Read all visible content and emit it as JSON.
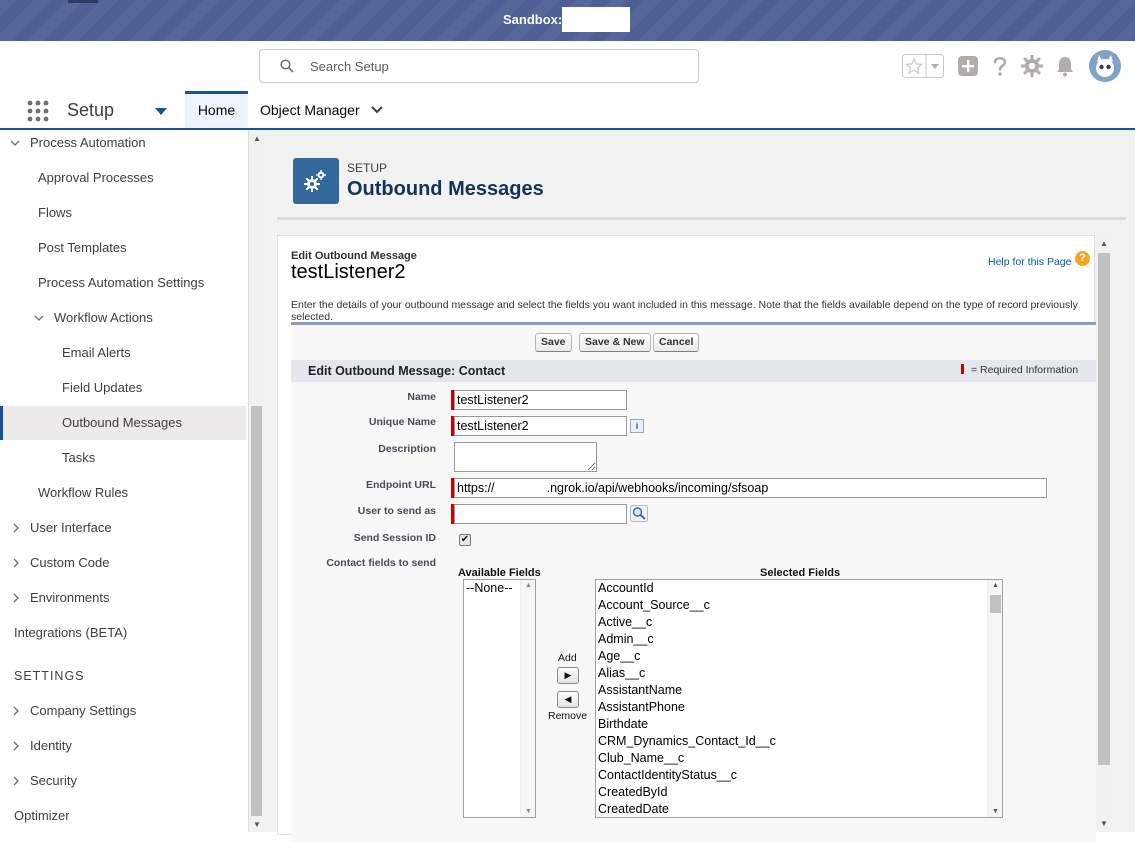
{
  "sandbox": {
    "label": "Sandbox:",
    "name": ""
  },
  "search": {
    "placeholder": "Search Setup"
  },
  "nav": {
    "app_name": "Setup",
    "tabs": [
      {
        "label": "Home"
      },
      {
        "label": "Object Manager"
      }
    ]
  },
  "sidebar": {
    "items": [
      {
        "label": "Process Automation"
      },
      {
        "label": "Approval Processes"
      },
      {
        "label": "Flows"
      },
      {
        "label": "Post Templates"
      },
      {
        "label": "Process Automation Settings"
      },
      {
        "label": "Workflow Actions"
      },
      {
        "label": "Email Alerts"
      },
      {
        "label": "Field Updates"
      },
      {
        "label": "Outbound Messages"
      },
      {
        "label": "Tasks"
      },
      {
        "label": "Workflow Rules"
      },
      {
        "label": "User Interface"
      },
      {
        "label": "Custom Code"
      },
      {
        "label": "Environments"
      },
      {
        "label": "Integrations (BETA)"
      },
      {
        "label": "Company Settings"
      },
      {
        "label": "Identity"
      },
      {
        "label": "Security"
      },
      {
        "label": "Optimizer"
      }
    ],
    "settings_heading": "SETTINGS"
  },
  "page_header": {
    "eyebrow": "SETUP",
    "title": "Outbound Messages"
  },
  "content": {
    "crumb": "Edit Outbound Message",
    "record_name": "testListener2",
    "help_link": "Help for this Page",
    "intro": "Enter the details of your outbound message and select the fields you want included in this message. Note that the fields available depend on the type of record previously selected.",
    "buttons": {
      "save": "Save",
      "save_new": "Save & New",
      "cancel": "Cancel"
    },
    "section_title": "Edit Outbound Message: Contact",
    "required_info": "= Required Information",
    "fields": {
      "name_label": "Name",
      "name_value": "testListener2",
      "unique_label": "Unique Name",
      "unique_value": "testListener2",
      "desc_label": "Description",
      "endpoint_label": "Endpoint URL",
      "endpoint_value": "https://               .ngrok.io/api/webhooks/incoming/sfsoap",
      "user_label": "User to send as",
      "session_label": "Send Session ID",
      "contact_fields_label": "Contact fields to send"
    },
    "available_header": "Available Fields",
    "selected_header": "Selected Fields",
    "available_fields": [
      "--None--"
    ],
    "selected_fields": [
      "AccountId",
      "Account_Source__c",
      "Active__c",
      "Admin__c",
      "Age__c",
      "Alias__c",
      "AssistantName",
      "AssistantPhone",
      "Birthdate",
      "CRM_Dynamics_Contact_Id__c",
      "Club_Name__c",
      "ContactIdentityStatus__c",
      "CreatedById",
      "CreatedDate"
    ],
    "add_label": "Add",
    "remove_label": "Remove"
  },
  "colors": {
    "banner": "#4d5f94",
    "brand": "#1b5297",
    "required": "#cc0000",
    "page_icon": "#34699b"
  }
}
